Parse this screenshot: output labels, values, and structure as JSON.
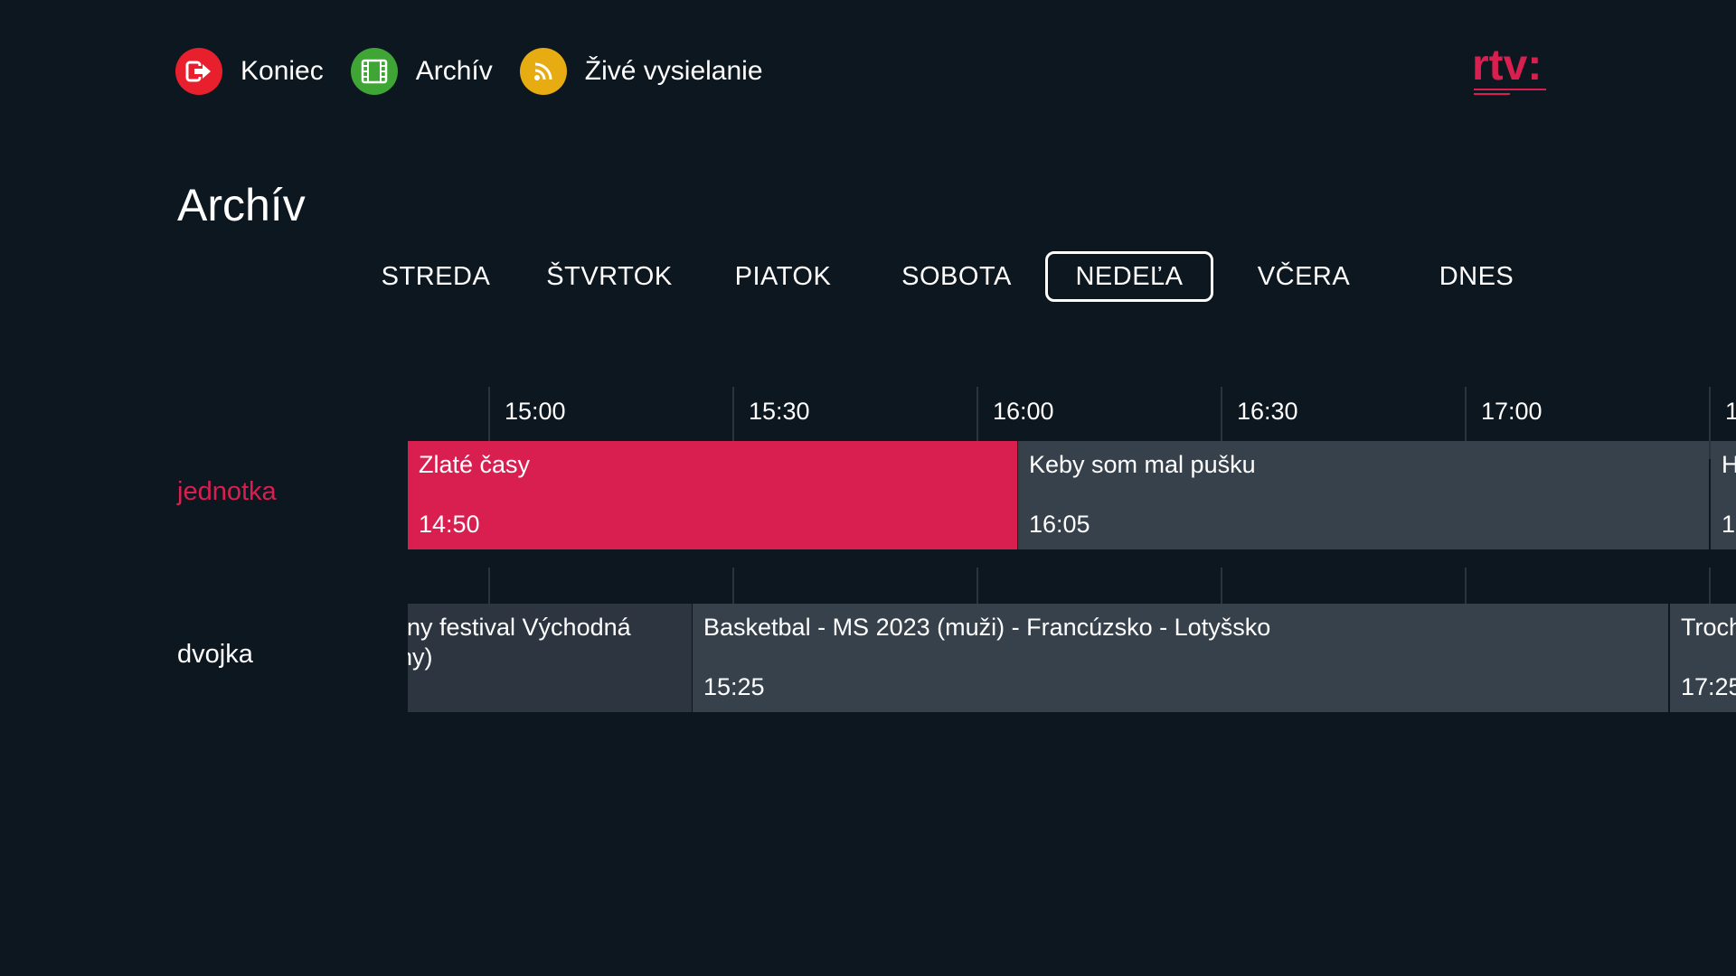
{
  "nav": [
    {
      "label": "Koniec",
      "icon": "exit-icon",
      "color": "#e8202e"
    },
    {
      "label": "Archív",
      "icon": "film-icon",
      "color": "#3fa535"
    },
    {
      "label": "Živé vysielanie",
      "icon": "rss-icon",
      "color": "#e6ac12"
    }
  ],
  "logo": {
    "text": "rtv:",
    "color": "#d81f50"
  },
  "page_title": "Archív",
  "days": [
    "STREDA",
    "ŠTVRTOK",
    "PIATOK",
    "SOBOTA",
    "NEDEĽA",
    "VČERA",
    "DNES"
  ],
  "selected_day": "NEDEĽA",
  "times": [
    "15:00",
    "15:30",
    "16:00",
    "16:30",
    "17:00",
    "1"
  ],
  "channels": [
    {
      "name": "jednotka",
      "active": true,
      "programs": [
        {
          "title": "Zlaté časy",
          "time": "14:50",
          "selected": true
        },
        {
          "title": "Keby som mal pušku",
          "time": "16:05"
        },
        {
          "title": "H",
          "time": "1"
        }
      ]
    },
    {
      "name": "dvojka",
      "active": false,
      "programs": [
        {
          "title": "rny festival Východná\nny)",
          "time": ""
        },
        {
          "title": "Basketbal - MS 2023 (muži) - Francúzsko - Lotyšsko",
          "time": "15:25"
        },
        {
          "title": "Troch",
          "time": "17:25"
        }
      ]
    }
  ],
  "colors": {
    "background": "#0d1720",
    "accent": "#d81f50",
    "program": "#37414c",
    "gridline": "#2a343e"
  }
}
